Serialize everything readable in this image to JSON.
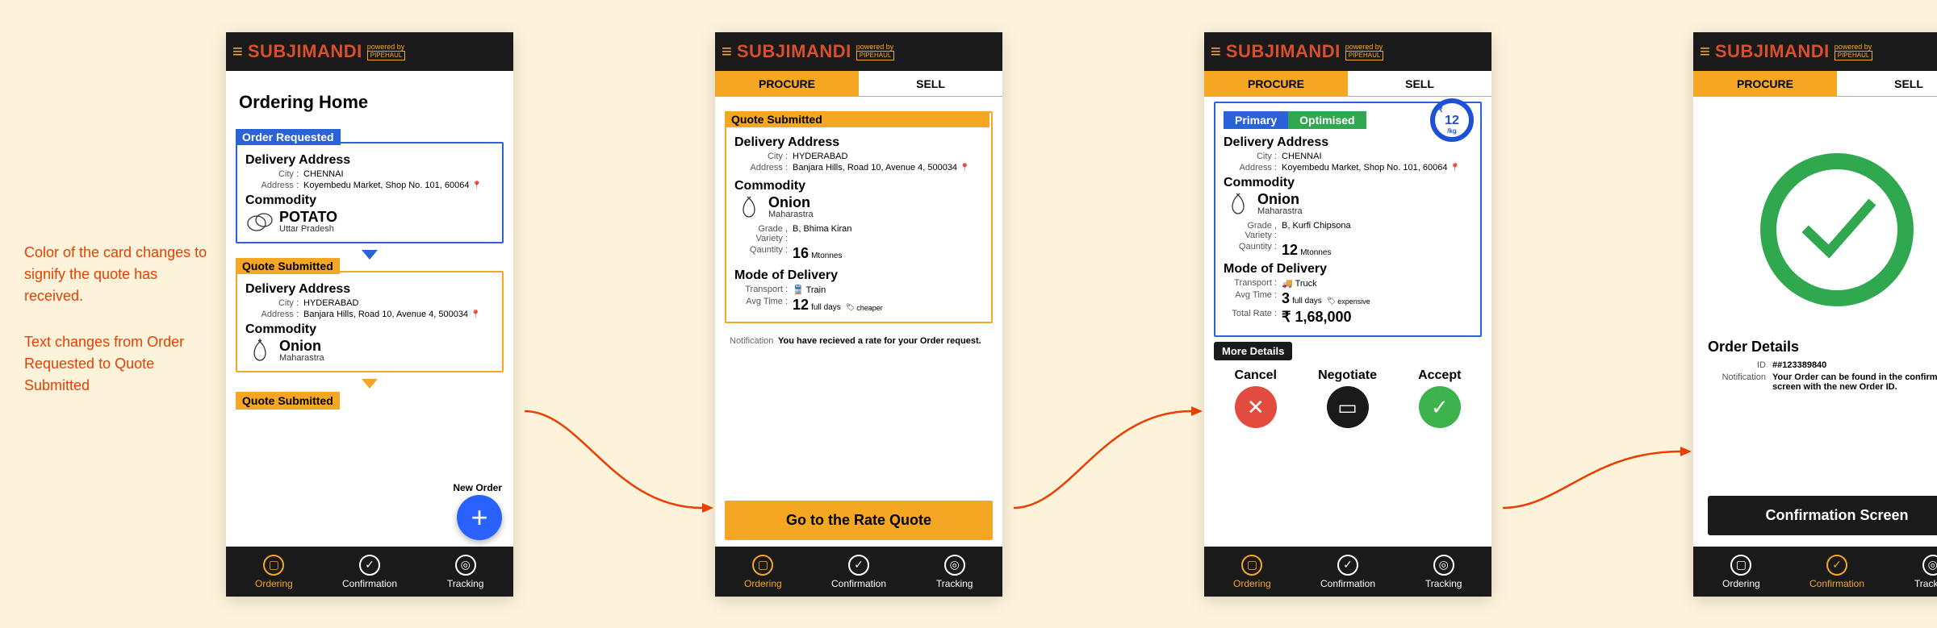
{
  "annotation": {
    "p1": "Color of the card changes to signify the quote has received.",
    "p2": "Text changes from Order Requested to Quote Submitted"
  },
  "brand": "SUBJIMANDI",
  "powered_by": "powered by",
  "powered_brand": "PIPEHAUL",
  "tabs": {
    "procure": "PROCURE",
    "sell": "SELL"
  },
  "nav": {
    "ordering": "Ordering",
    "confirmation": "Confirmation",
    "tracking": "Tracking"
  },
  "labels": {
    "delivery_address": "Delivery Address",
    "city": "City :",
    "address": "Address :",
    "commodity": "Commodity",
    "grade_variety": "Grade , Variety :",
    "quantity": "Qauntity :",
    "mode_of_delivery": "Mode of Delivery",
    "transport": "Transport :",
    "avg_time": "Avg Time :",
    "total_rate": "Total Rate :",
    "notification": "Notification",
    "id": "ID"
  },
  "screen1": {
    "title": "Ordering Home",
    "cards": [
      {
        "tag": "Order Requested",
        "city": "CHENNAI",
        "address": "Koyembedu Market, Shop No. 101, 60064",
        "commodity": "POTATO",
        "origin": "Uttar Pradesh"
      },
      {
        "tag": "Quote Submitted",
        "city": "HYDERABAD",
        "address": "Banjara Hills, Road 10, Avenue 4, 500034",
        "commodity": "Onion",
        "origin": "Maharastra"
      }
    ],
    "extra_tag": "Quote Submitted",
    "new_order": "New Order"
  },
  "screen2": {
    "tag": "Quote Submitted",
    "city": "HYDERABAD",
    "address": "Banjara Hills, Road 10, Avenue 4, 500034",
    "commodity": "Onion",
    "origin": "Maharastra",
    "grade": "B, Bhima Kiran",
    "qty_val": "16",
    "qty_unit": "Mtonnes",
    "transport": "Train",
    "avg_time_val": "12",
    "avg_time_unit": "full days",
    "price_tag": "cheaper",
    "notification": "You have recieved a rate for your Order request.",
    "cta": "Go to the Rate Quote"
  },
  "screen3": {
    "pill_primary": "Primary",
    "pill_optimised": "Optimised",
    "rate_badge": "12",
    "rate_per": "/kg",
    "rate_currency": "₹",
    "city": "CHENNAI",
    "address": "Koyembedu Market, Shop No. 101, 60064",
    "commodity": "Onion",
    "origin": "Maharastra",
    "grade": "B, Kurfi Chipsona",
    "qty_val": "12",
    "qty_unit": "Mtonnes",
    "transport": "Truck",
    "avg_time_val": "3",
    "avg_time_unit": "full days",
    "price_tag": "expensive",
    "total_rate": "₹ 1,68,000",
    "more_details": "More Details",
    "actions": {
      "cancel": "Cancel",
      "negotiate": "Negotiate",
      "accept": "Accept"
    }
  },
  "screen4": {
    "order_details": "Order Details",
    "order_id": "##123389840",
    "notification": "Your Order can be found in the confirmation screen with the new Order ID.",
    "cta": "Confirmation Screen"
  }
}
